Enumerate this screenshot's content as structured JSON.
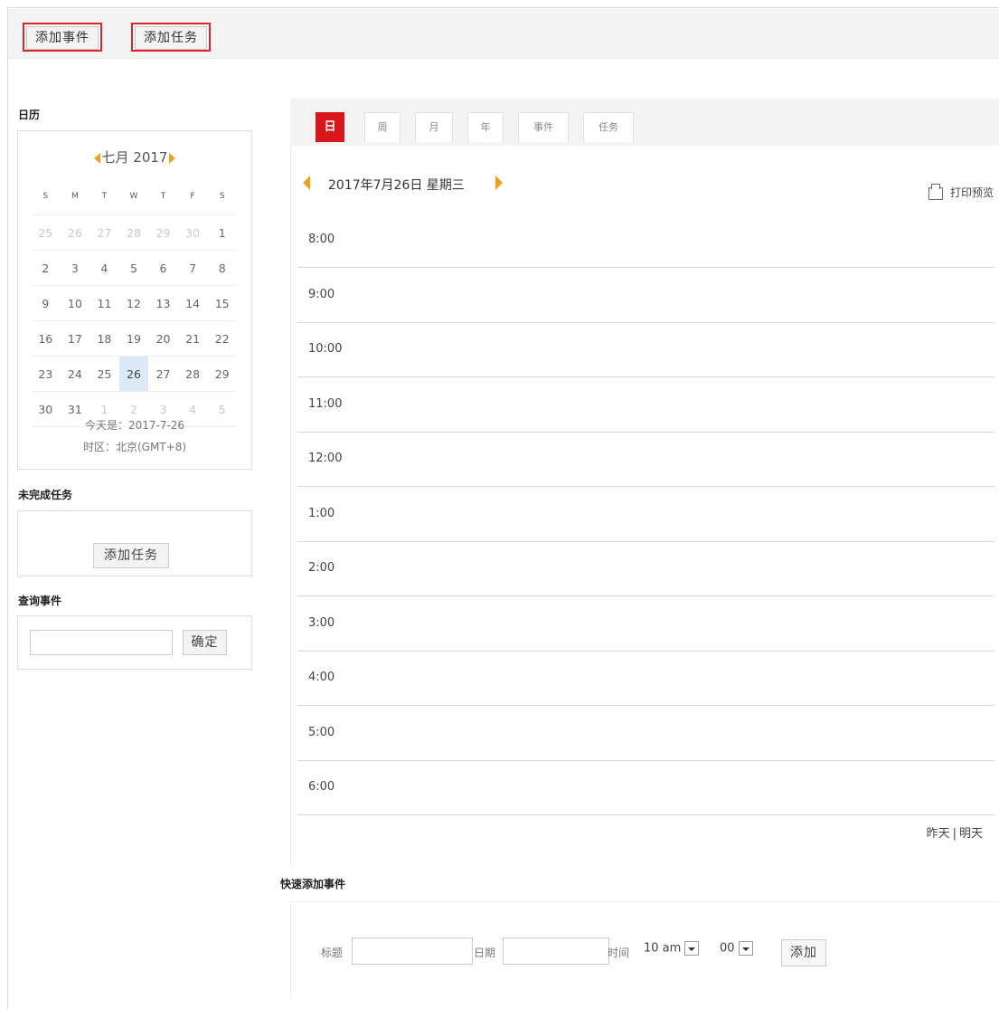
{
  "toolbar": {
    "add_event": "添加事件",
    "add_task": "添加任务"
  },
  "sidebar": {
    "calendar_title": "日历",
    "mini_calendar": {
      "month_label": "七月 2017",
      "weekdays": [
        "S",
        "M",
        "T",
        "W",
        "T",
        "F",
        "S"
      ],
      "weeks": [
        [
          "25",
          "26",
          "27",
          "28",
          "29",
          "30",
          "1"
        ],
        [
          "2",
          "3",
          "4",
          "5",
          "6",
          "7",
          "8"
        ],
        [
          "9",
          "10",
          "11",
          "12",
          "13",
          "14",
          "15"
        ],
        [
          "16",
          "17",
          "18",
          "19",
          "20",
          "21",
          "22"
        ],
        [
          "23",
          "24",
          "25",
          "26",
          "27",
          "28",
          "29"
        ],
        [
          "30",
          "31",
          "1",
          "2",
          "3",
          "4",
          "5"
        ]
      ],
      "selected_day": "26",
      "today_text": "今天是：2017-7-26",
      "timezone_text": "时区：北京(GMT+8)"
    },
    "pending_tasks_title": "未完成任务",
    "pending_add_task": "添加任务",
    "search_title": "查询事件",
    "search_value": "",
    "search_button": "确定"
  },
  "tabs": [
    "日",
    "周",
    "月",
    "年",
    "事件",
    "任务"
  ],
  "active_tab": "日",
  "day_view": {
    "date_label": "2017年7月26日 星期三",
    "print_label": "打印预览",
    "hours": [
      "8:00",
      "9:00",
      "10:00",
      "11:00",
      "12:00",
      "1:00",
      "2:00",
      "3:00",
      "4:00",
      "5:00",
      "6:00"
    ],
    "prev_label": "昨天",
    "separator": "|",
    "next_label": "明天"
  },
  "quick_add": {
    "title": "快速添加事件",
    "title_label": "标题",
    "title_value": "",
    "date_label": "日期",
    "date_value": "",
    "time_label": "时间",
    "hour_value": "10 am",
    "minute_value": "00",
    "add_button": "添加"
  }
}
